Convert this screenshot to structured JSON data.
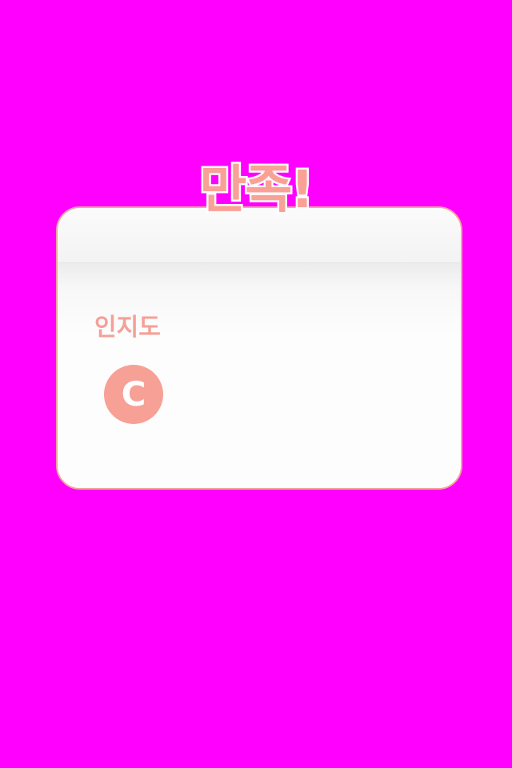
{
  "result": {
    "title": "만족!",
    "stat_label": "인지도",
    "grade": "C"
  },
  "colors": {
    "background": "#ff00ff",
    "accent": "#f7a096",
    "panel": "#fcfcfc",
    "panel_border": "#f4a59d"
  }
}
